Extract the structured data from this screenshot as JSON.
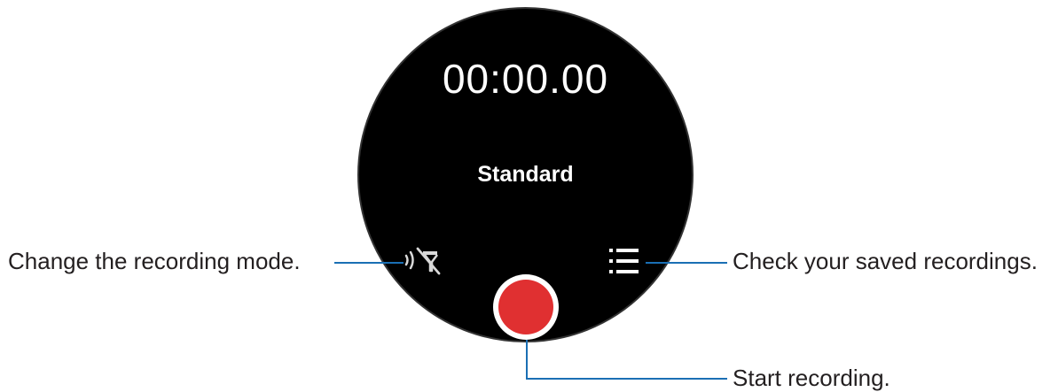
{
  "watch": {
    "timer": "00:00.00",
    "mode": "Standard"
  },
  "buttons": {
    "mode_icon": "voice-zoom-off-icon",
    "list_icon": "list-icon",
    "record_icon": "record-icon"
  },
  "callouts": {
    "mode": "Change the recording mode.",
    "list": "Check your saved recordings.",
    "record": "Start recording."
  },
  "colors": {
    "background": "#ffffff",
    "watch_face": "#000000",
    "record_red": "#e03031",
    "leader_line": "#1a6fb4",
    "callout_text": "#231f20"
  }
}
